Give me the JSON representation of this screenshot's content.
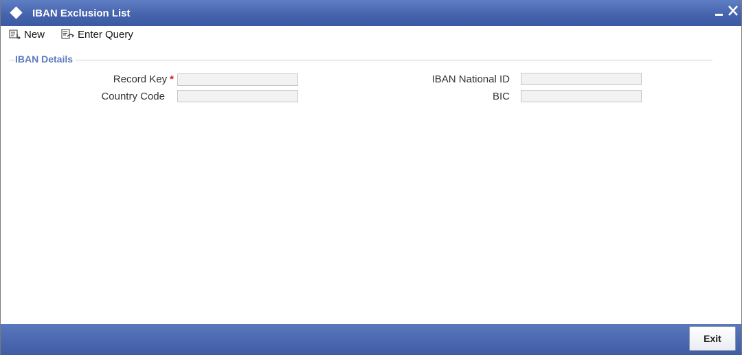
{
  "window": {
    "title": "IBAN Exclusion List",
    "icon": "diamond-icon",
    "controls": {
      "minimize_icon": "minimize-icon",
      "close_icon": "close-icon"
    }
  },
  "toolbar": {
    "new_label": "New",
    "new_icon": "new-record-icon",
    "enter_query_label": "Enter Query",
    "enter_query_icon": "enter-query-icon"
  },
  "section": {
    "title": "IBAN Details"
  },
  "fields": {
    "record_key": {
      "label": "Record Key",
      "required_mark": "*",
      "value": ""
    },
    "country_code": {
      "label": "Country Code",
      "value": ""
    },
    "iban_national_id": {
      "label": "IBAN National ID",
      "value": ""
    },
    "bic": {
      "label": "BIC",
      "value": ""
    }
  },
  "footer": {
    "exit_label": "Exit"
  },
  "colors": {
    "titlebar": "#4664ad",
    "section_title": "#5b7bbe",
    "required": "#d01818",
    "field_bg": "#f2f2f2"
  }
}
